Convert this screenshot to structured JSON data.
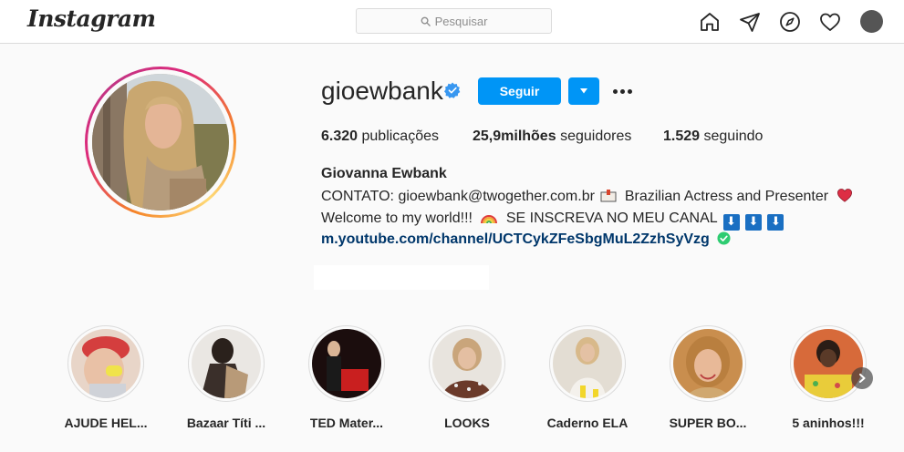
{
  "topbar": {
    "logo": "Instagram",
    "search_placeholder": "Pesquisar",
    "nav_icons": [
      "home-icon",
      "direct-icon",
      "explore-icon",
      "activity-heart-icon",
      "profile-avatar"
    ]
  },
  "profile": {
    "username": "gioewbank",
    "verified": true,
    "follow_label": "Seguir",
    "stats": [
      {
        "count": "6.320",
        "label": "publicações"
      },
      {
        "count": "25,9milhões",
        "label": "seguidores"
      },
      {
        "count": "1.529",
        "label": "seguindo"
      }
    ],
    "full_name": "Giovanna Ewbank",
    "bio_line1_a": "CONTATO: gioewbank@twogether.com.br",
    "bio_line1_b": "Brazilian Actress and Presenter",
    "bio_line2_a": "Welcome to my world!!!",
    "bio_line2_b": "SE INSCREVA NO MEU CANAL",
    "bio_arrow": "⬇",
    "bio_link": "m.youtube.com/channel/UCTCykZFeSbgMuL2ZzhSyVzg"
  },
  "highlights": [
    {
      "label": "AJUDE HEL..."
    },
    {
      "label": "Bazaar Títi ..."
    },
    {
      "label": "TED Mater..."
    },
    {
      "label": "LOOKS"
    },
    {
      "label": "Caderno ELA"
    },
    {
      "label": "SUPER BO..."
    },
    {
      "label": "5 aninhos!!!"
    }
  ],
  "colors": {
    "accent": "#0095f6",
    "link": "#00376b",
    "text": "#262626",
    "muted": "#8e8e8e",
    "border": "#dbdbdb",
    "background": "#fafafa"
  }
}
